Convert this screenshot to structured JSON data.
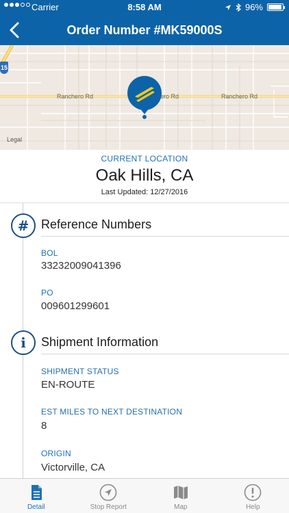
{
  "status_bar": {
    "carrier": "Carrier",
    "time": "8:58 AM",
    "battery": "96%",
    "battery_level": 0.96
  },
  "nav": {
    "title": "Order Number #MK59000S"
  },
  "map": {
    "road_label_1": "Ranchero Rd",
    "road_label_2": "Ranchero Rd",
    "road_label_3": "Ranchero Rd",
    "legal": "Legal",
    "highway_shield": "15"
  },
  "current_location": {
    "label": "CURRENT LOCATION",
    "city": "Oak Hills, CA",
    "last_updated": "Last Updated: 12/27/2016"
  },
  "reference": {
    "icon_glyph": "#",
    "title": "Reference Numbers",
    "bol_label": "BOL",
    "bol_value": "33232009041396",
    "po_label": "PO",
    "po_value": "009601299601"
  },
  "shipment": {
    "icon_glyph": "i",
    "title": "Shipment Information",
    "status_label": "SHIPMENT STATUS",
    "status_value": "EN-ROUTE",
    "miles_label": "EST MILES TO NEXT DESTINATION",
    "miles_value": "8",
    "origin_label": "ORIGIN",
    "origin_value": "Victorville, CA"
  },
  "tabs": [
    {
      "label": "Detail",
      "icon": "document-icon",
      "active": true
    },
    {
      "label": "Stop Report",
      "icon": "navigation-arrow-icon",
      "active": false
    },
    {
      "label": "Map",
      "icon": "map-icon",
      "active": false
    },
    {
      "label": "Help",
      "icon": "exclamation-icon",
      "active": false
    }
  ],
  "colors": {
    "brand_blue": "#0d63a8",
    "label_blue": "#1f70b3",
    "icon_navy": "#1b4d80",
    "pin_yellow": "#f2c81c"
  }
}
